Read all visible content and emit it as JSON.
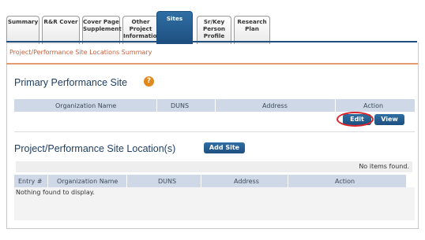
{
  "tabs": [
    {
      "label": "Summary",
      "active": false
    },
    {
      "label": "R&R Cover",
      "active": false
    },
    {
      "label": "Cover Page\nSupplement",
      "active": false
    },
    {
      "label": "Other\nProject\nInformation",
      "active": false
    },
    {
      "label": "Sites",
      "active": true
    },
    {
      "label": "Sr/Key\nPerson\nProfile",
      "active": false
    },
    {
      "label": "Research\nPlan",
      "active": false
    }
  ],
  "page": {
    "summary_title": "Project/Performance Site Locations Summary"
  },
  "primary": {
    "title": "Primary Performance Site",
    "help_icon": "?",
    "columns": [
      "Organization Name",
      "DUNS",
      "Address",
      "Action"
    ],
    "edit_label": "Edit",
    "view_label": "View"
  },
  "sites": {
    "title": "Project/Performance Site Location(s)",
    "add_label": "Add Site",
    "no_items": "No items found.",
    "columns": [
      "Entry #",
      "Organization Name",
      "DUNS",
      "Address",
      "Action"
    ],
    "empty_message": "Nothing found to display."
  },
  "colors": {
    "tab_active": "#1e4f80",
    "accent_orange": "#c9603c",
    "table_header": "#cfd8e6",
    "highlight_circle": "#d9252a"
  }
}
